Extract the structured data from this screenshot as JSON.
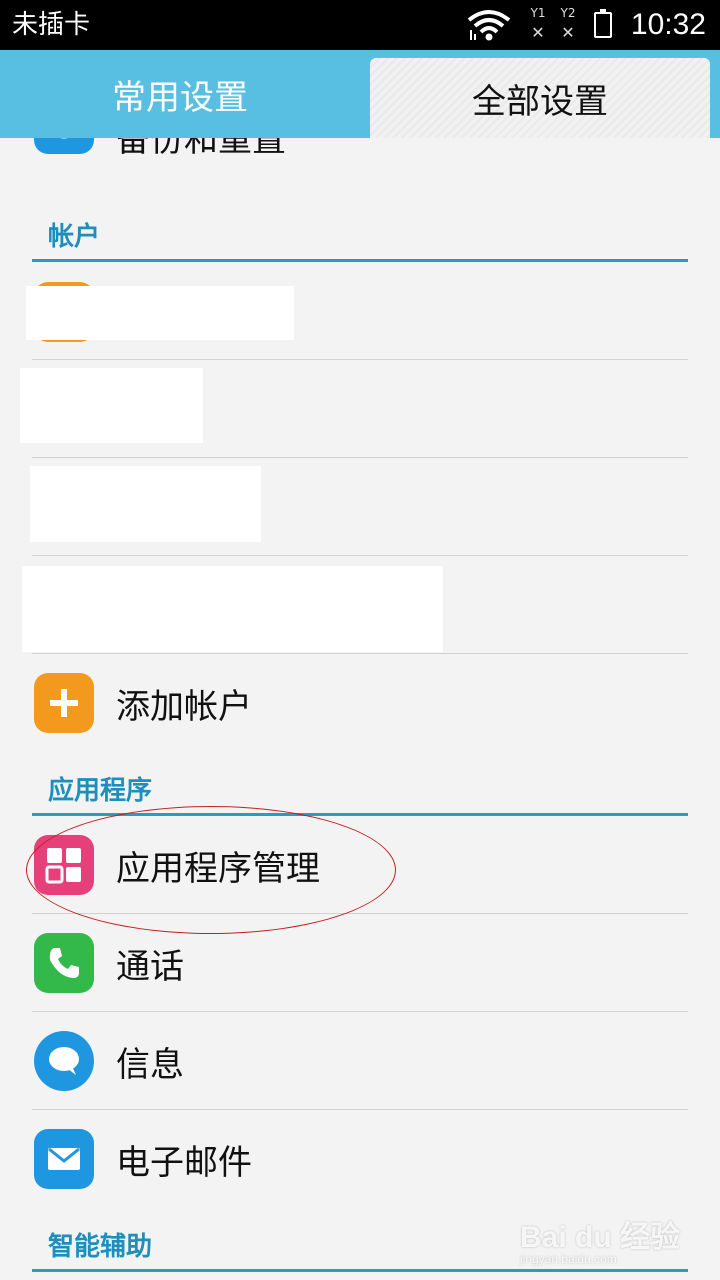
{
  "status_bar": {
    "carrier": "未插卡",
    "sim1_label": "Y1",
    "sim2_label": "Y2",
    "sim_no_signal": "✕",
    "time": "10:32"
  },
  "tabs": {
    "common": "常用设置",
    "all": "全部设置"
  },
  "rows": {
    "backup": "备份和重置",
    "add_account": "添加帐户",
    "app_manager": "应用程序管理",
    "calls": "通话",
    "messages": "信息",
    "email": "电子邮件"
  },
  "sections": {
    "accounts": "帐户",
    "apps": "应用程序",
    "accessibility": "智能辅助"
  },
  "colors": {
    "tab_bar": "#59bfe2",
    "section_line": "#2a9bc2",
    "add_icon": "#f39a1e",
    "apps_icon": "#e6407a",
    "calls_icon": "#33b84a",
    "messages_icon": "#1f96e0",
    "email_icon": "#1f96e0",
    "highlight_ellipse": "#c02020"
  },
  "icons": {
    "backup": "backup-icon",
    "add": "plus-icon",
    "apps": "grid-icon",
    "calls": "phone-icon",
    "messages": "speech-bubble-icon",
    "email": "envelope-icon"
  },
  "watermark": {
    "brand": "Bai du 经验",
    "url": "jingyan.baidu.com"
  }
}
